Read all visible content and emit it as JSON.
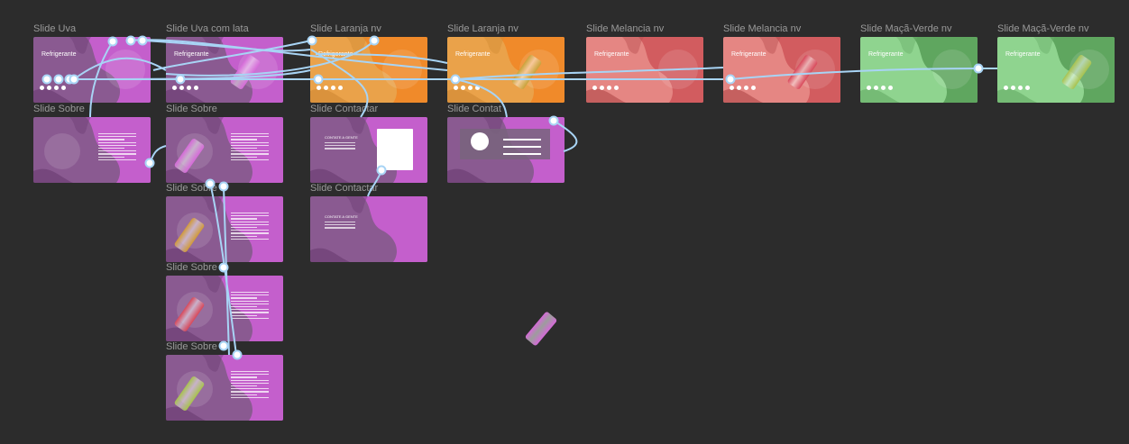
{
  "canvas": {
    "background": "#2c2c2c",
    "prototype_color": "#a8d4f5"
  },
  "frames": [
    {
      "id": "uva",
      "label": "Slide Uva",
      "kind": "hero",
      "theme": "grape",
      "title": "Refrigerante",
      "logo": "Mega\nKnife"
    },
    {
      "id": "uva-lata",
      "label": "Slide Uva com lata",
      "kind": "hero",
      "theme": "grape",
      "title": "Refrigerante",
      "logo": "Mega\nKnife",
      "can": "#d56ad8"
    },
    {
      "id": "laranja",
      "label": "Slide Laranja nv",
      "kind": "hero",
      "theme": "orange",
      "title": "Refrigerante",
      "logo": "Mega\nKnife"
    },
    {
      "id": "laranja-lata",
      "label": "Slide Laranja nv",
      "kind": "hero",
      "theme": "orange",
      "title": "Refrigerante",
      "logo": "Mega\nKnife",
      "can": "#c9a23a"
    },
    {
      "id": "melancia",
      "label": "Slide Melancia nv",
      "kind": "hero",
      "theme": "melon",
      "title": "Refrigerante",
      "logo": "Mega\nKnife"
    },
    {
      "id": "melancia-lata",
      "label": "Slide Melancia nv",
      "kind": "hero",
      "theme": "melon",
      "title": "Refrigerante",
      "logo": "Mega\nKnife",
      "can": "#d8485a"
    },
    {
      "id": "maca",
      "label": "Slide Maçã-Verde nv",
      "kind": "hero",
      "theme": "apple",
      "title": "Refrigerante",
      "logo": "Mega\nKnife"
    },
    {
      "id": "maca-lata",
      "label": "Slide Maçã-Verde nv",
      "kind": "hero",
      "theme": "apple",
      "title": "Refrigerante",
      "logo": "Mega\nKnife",
      "can": "#a8c24e"
    },
    {
      "id": "sobre1",
      "label": "Slide Sobre",
      "kind": "about",
      "theme": "purple"
    },
    {
      "id": "sobre2",
      "label": "Slide Sobre",
      "kind": "about",
      "theme": "purple",
      "can": "#d56ad8"
    },
    {
      "id": "sobre3",
      "label": "Slide Sobre",
      "kind": "about",
      "theme": "purple",
      "can": "#d19a3a"
    },
    {
      "id": "sobre4",
      "label": "Slide Sobre",
      "kind": "about",
      "theme": "purple",
      "can": "#d8485a"
    },
    {
      "id": "sobre5",
      "label": "Slide Sobre",
      "kind": "about",
      "theme": "purple",
      "can": "#a8c24e"
    },
    {
      "id": "contatar1",
      "label": "Slide Contactar",
      "kind": "contact",
      "theme": "purple",
      "heading": "CONTATE A GENTE"
    },
    {
      "id": "contatar2",
      "label": "Slide Contactar",
      "kind": "contact",
      "theme": "purple",
      "heading": "CONTATE A GENTE"
    },
    {
      "id": "contat3",
      "label": "Slide Contat",
      "kind": "contact2",
      "theme": "purple"
    }
  ],
  "themes": {
    "grape": {
      "bg": "#8a5a91",
      "accent": "#c45fcc",
      "dark": "#6d3f75"
    },
    "orange": {
      "bg": "#eaa24a",
      "accent": "#f08a2a",
      "dark": "#d38c36"
    },
    "melon": {
      "bg": "#e58683",
      "accent": "#d25c5f",
      "dark": "#b85050"
    },
    "apple": {
      "bg": "#8fd48f",
      "accent": "#5fa65f",
      "dark": "#6ab06a"
    },
    "purple": {
      "bg": "#8a5a91",
      "accent": "#c45fcc",
      "dark": "#6d3f75"
    }
  },
  "floating_can": {
    "color": "#d56ad8"
  }
}
